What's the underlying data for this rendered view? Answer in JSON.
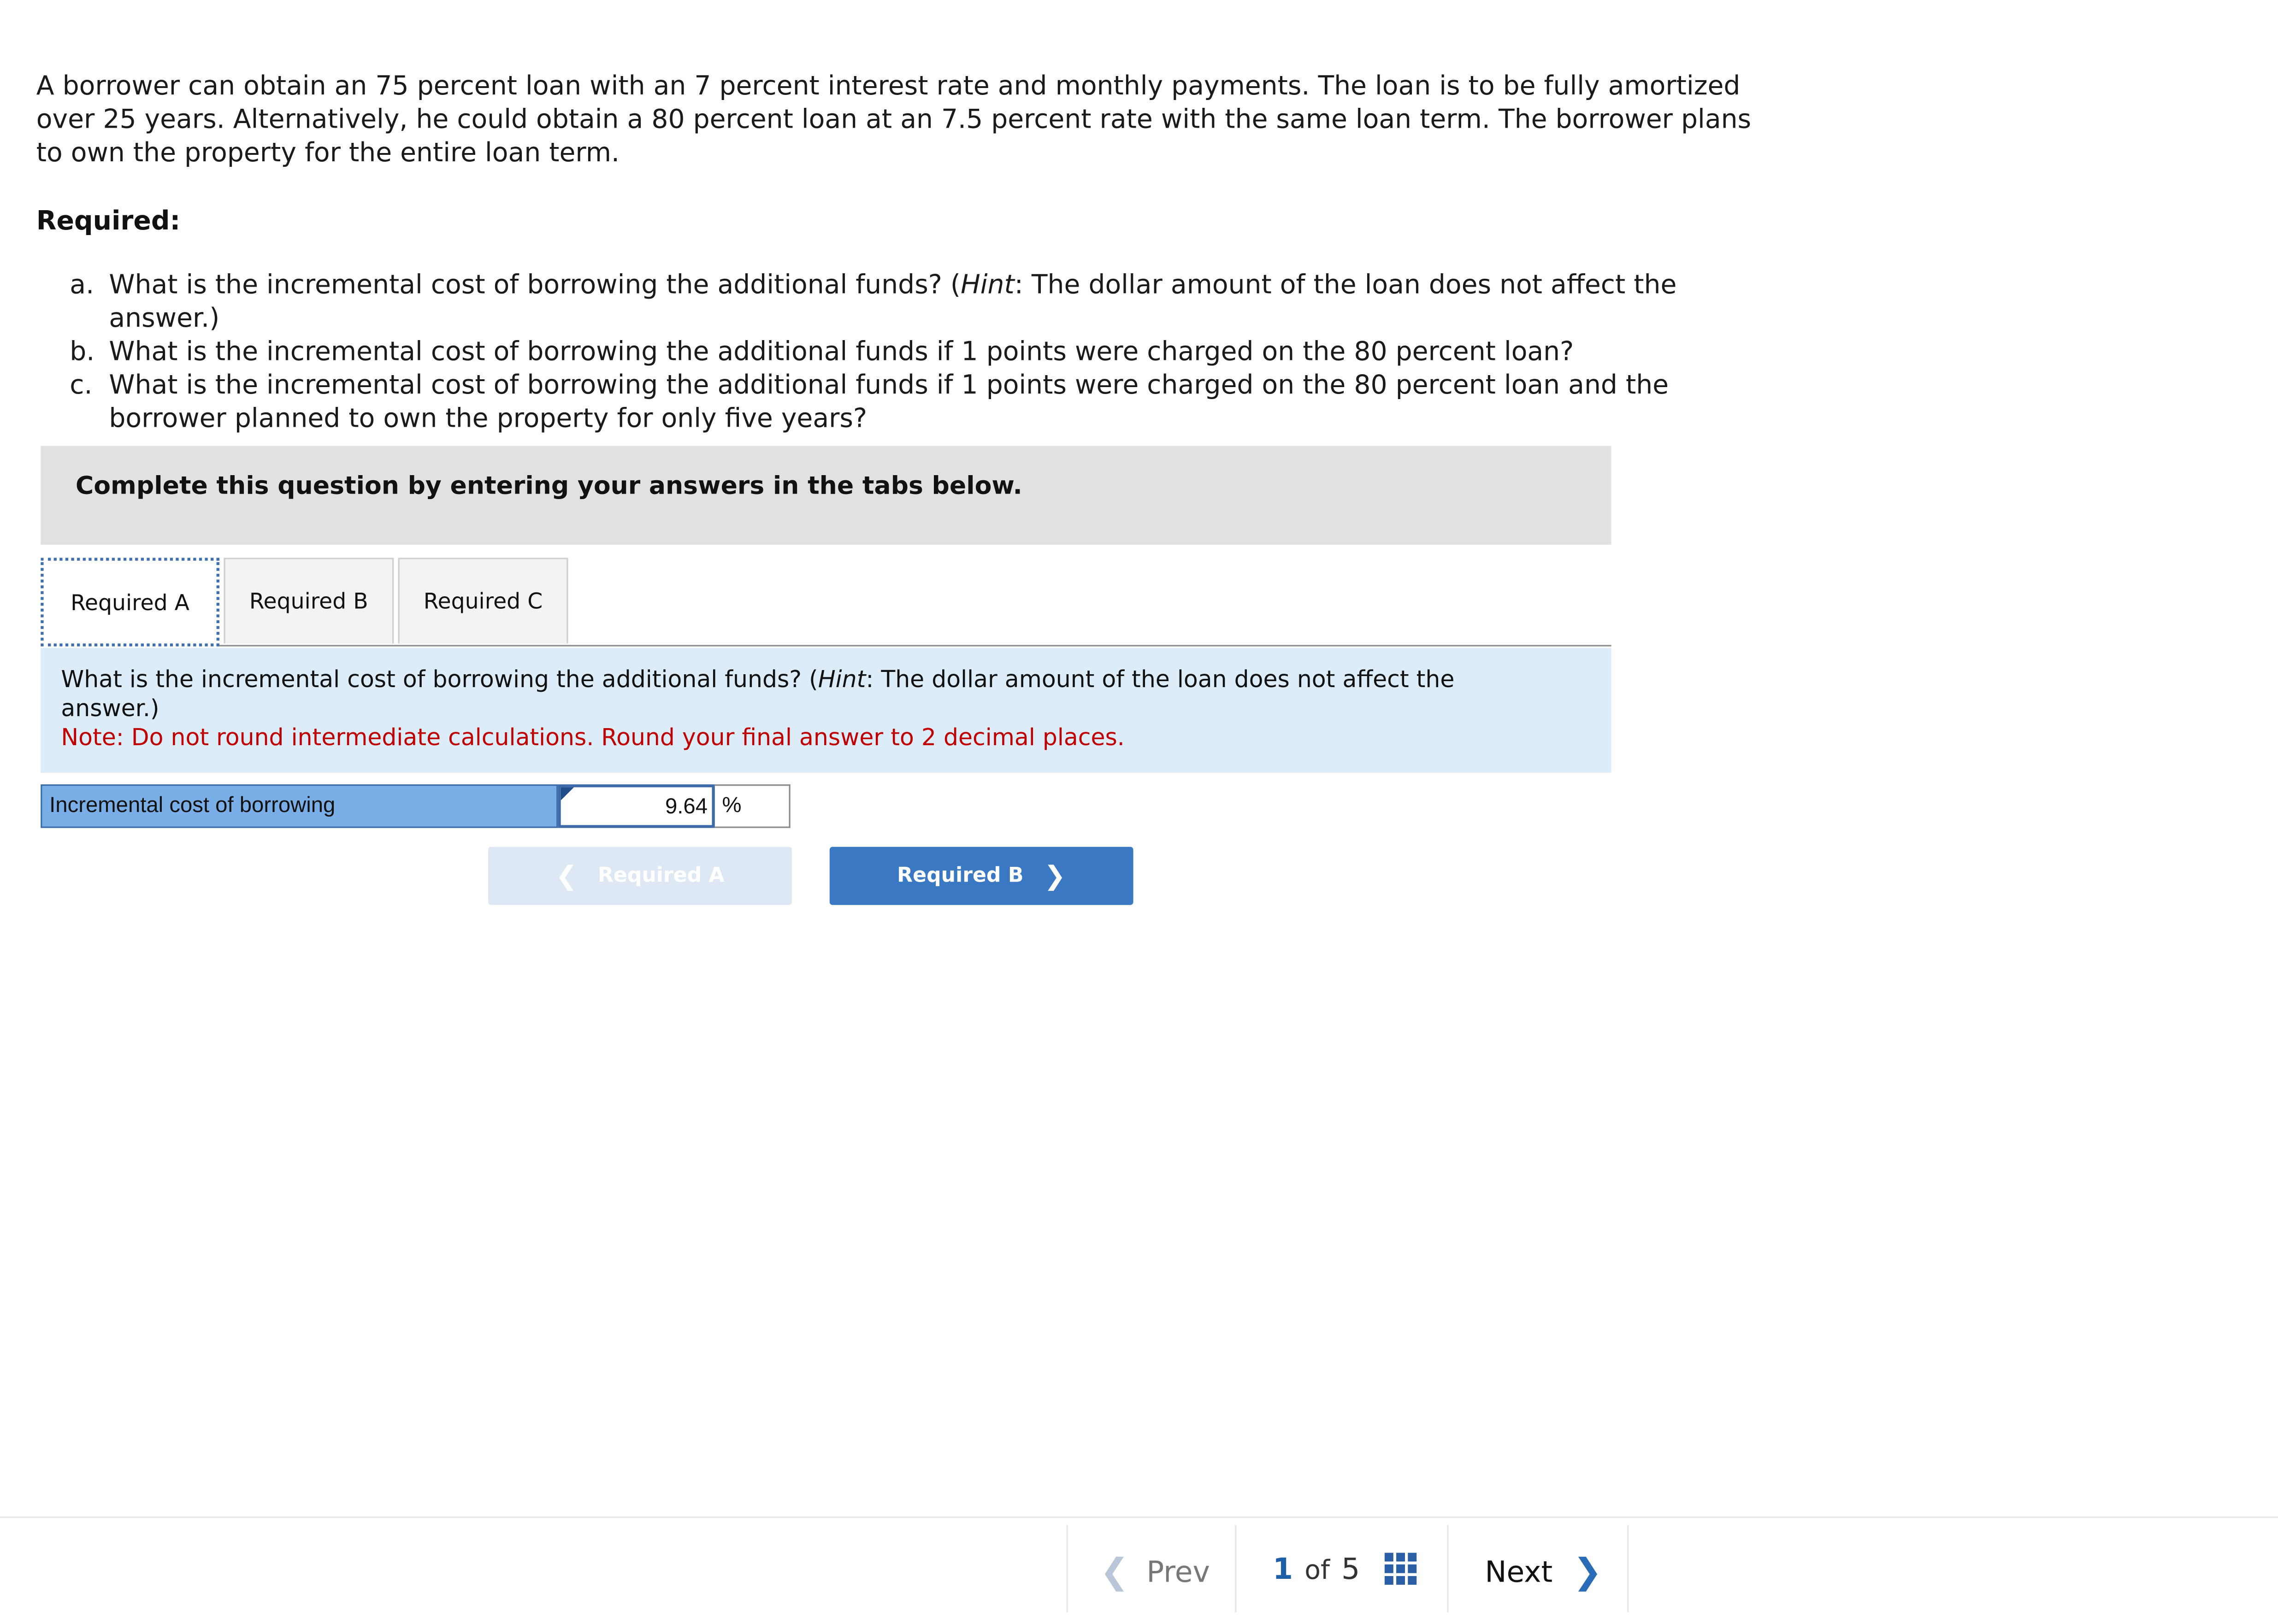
{
  "intro": {
    "p1": "A borrower can obtain an 75 percent loan with an 7 percent interest rate and monthly payments. The loan is to be fully amortized over 25 years. Alternatively, he could obtain a 80 percent loan at an 7.5 percent rate with the same loan term. The borrower plans to own the property for the entire loan term."
  },
  "required_heading": "Required:",
  "questions": [
    {
      "label": "a.",
      "pre": "What is the incremental cost of borrowing the additional funds? (",
      "hint": "Hint",
      "post": ": The dollar amount of the loan does not affect the answer.)"
    },
    {
      "label": "b.",
      "text": "What is the incremental cost of borrowing the additional funds if 1 points were charged on the 80 percent loan?"
    },
    {
      "label": "c.",
      "text": "What is the incremental cost of borrowing the additional funds if 1 points were charged on the 80 percent loan and the borrower planned to own the property for only five years?"
    }
  ],
  "banner": "Complete this question by entering your answers in the tabs below.",
  "tabs": [
    "Required A",
    "Required B",
    "Required C"
  ],
  "active_tab": "Required A",
  "prompt": {
    "pre": "What is the incremental cost of borrowing the additional funds? (",
    "hint": "Hint",
    "post": ": The dollar amount of the loan does not affect the answer.)",
    "note": "Note: Do not round intermediate calculations. Round your final answer to 2 decimal places."
  },
  "answer": {
    "label": "Incremental cost of borrowing",
    "value": "9.64",
    "unit": "%"
  },
  "nav_buttons": {
    "prev_label": "Required A",
    "next_label": "Required B"
  },
  "footer": {
    "prev": "Prev",
    "current_page": "1",
    "of": "of",
    "total_pages": "5",
    "next": "Next"
  },
  "colors": {
    "banner_bg": "#e1e1e1",
    "prompt_bg": "#dcecf9",
    "note_red": "#c00000",
    "label_blue": "#7aaee6",
    "primary_button": "#3b78c3",
    "disabled_button": "#dde8f4"
  },
  "icons": {
    "prev_chevron": "chevron-left-icon",
    "next_chevron": "chevron-right-icon",
    "page_grid": "grid-icon"
  }
}
